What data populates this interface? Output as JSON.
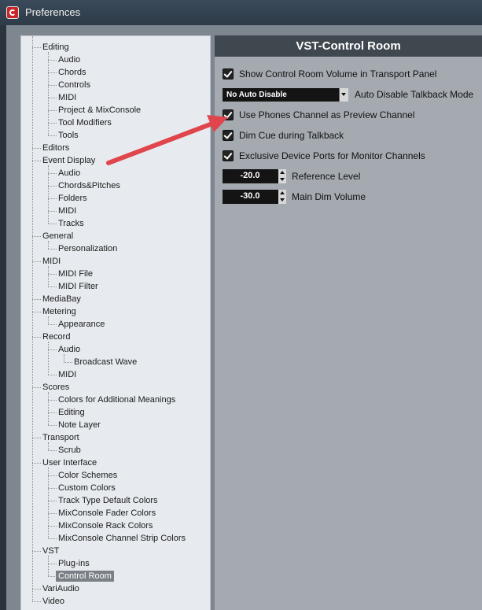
{
  "window": {
    "title": "Preferences"
  },
  "tree": [
    {
      "label": "Editing",
      "level": 0
    },
    {
      "label": "Audio",
      "level": 1
    },
    {
      "label": "Chords",
      "level": 1
    },
    {
      "label": "Controls",
      "level": 1
    },
    {
      "label": "MIDI",
      "level": 1
    },
    {
      "label": "Project & MixConsole",
      "level": 1
    },
    {
      "label": "Tool Modifiers",
      "level": 1
    },
    {
      "label": "Tools",
      "level": 1
    },
    {
      "label": "Editors",
      "level": 0
    },
    {
      "label": "Event Display",
      "level": 0
    },
    {
      "label": "Audio",
      "level": 1
    },
    {
      "label": "Chords&Pitches",
      "level": 1
    },
    {
      "label": "Folders",
      "level": 1
    },
    {
      "label": "MIDI",
      "level": 1
    },
    {
      "label": "Tracks",
      "level": 1
    },
    {
      "label": "General",
      "level": 0
    },
    {
      "label": "Personalization",
      "level": 1
    },
    {
      "label": "MIDI",
      "level": 0
    },
    {
      "label": "MIDI File",
      "level": 1
    },
    {
      "label": "MIDI Filter",
      "level": 1
    },
    {
      "label": "MediaBay",
      "level": 0
    },
    {
      "label": "Metering",
      "level": 0
    },
    {
      "label": "Appearance",
      "level": 1
    },
    {
      "label": "Record",
      "level": 0
    },
    {
      "label": "Audio",
      "level": 1
    },
    {
      "label": "Broadcast Wave",
      "level": 2
    },
    {
      "label": "MIDI",
      "level": 1
    },
    {
      "label": "Scores",
      "level": 0
    },
    {
      "label": "Colors for Additional Meanings",
      "level": 1
    },
    {
      "label": "Editing",
      "level": 1
    },
    {
      "label": "Note Layer",
      "level": 1
    },
    {
      "label": "Transport",
      "level": 0
    },
    {
      "label": "Scrub",
      "level": 1
    },
    {
      "label": "User Interface",
      "level": 0
    },
    {
      "label": "Color Schemes",
      "level": 1
    },
    {
      "label": "Custom Colors",
      "level": 1
    },
    {
      "label": "Track Type Default Colors",
      "level": 1
    },
    {
      "label": "MixConsole Fader Colors",
      "level": 1
    },
    {
      "label": "MixConsole Rack Colors",
      "level": 1
    },
    {
      "label": "MixConsole Channel Strip Colors",
      "level": 1
    },
    {
      "label": "VST",
      "level": 0
    },
    {
      "label": "Plug-ins",
      "level": 1
    },
    {
      "label": "Control Room",
      "level": 1,
      "selected": true
    },
    {
      "label": "VariAudio",
      "level": 0
    },
    {
      "label": "Video",
      "level": 0
    }
  ],
  "panel": {
    "title": "VST-Control Room",
    "show_volume_label": "Show Control Room Volume in Transport Panel",
    "show_volume_checked": true,
    "talkback_dropdown_value": "No Auto Disable",
    "talkback_label": "Auto Disable Talkback Mode",
    "phones_preview_label": "Use Phones Channel as Preview Channel",
    "phones_preview_checked": true,
    "dim_cue_label": "Dim Cue during Talkback",
    "dim_cue_checked": true,
    "exclusive_ports_label": "Exclusive Device Ports for Monitor Channels",
    "exclusive_ports_checked": true,
    "reference_level_value": "-20.0",
    "reference_level_label": "Reference Level",
    "main_dim_value": "-30.0",
    "main_dim_label": "Main Dim Volume"
  },
  "colors": {
    "annotation_arrow": "#e0454c",
    "header_bg": "#3f474f",
    "panel_bg": "#a4aab0"
  }
}
